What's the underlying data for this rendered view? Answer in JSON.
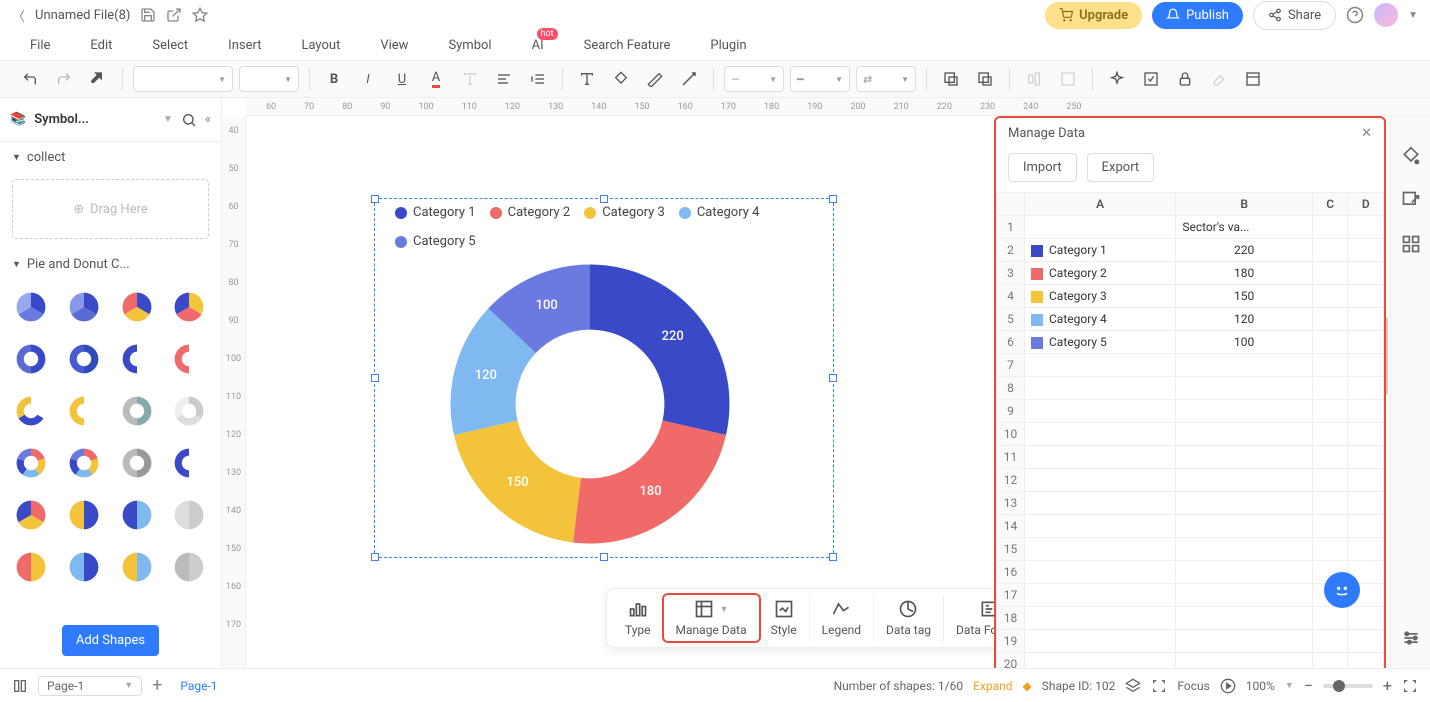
{
  "titlebar": {
    "filename": "Unnamed File(8)",
    "upgrade": "Upgrade",
    "publish": "Publish",
    "share": "Share"
  },
  "menubar": {
    "file": "File",
    "edit": "Edit",
    "select": "Select",
    "insert": "Insert",
    "layout": "Layout",
    "view": "View",
    "symbol": "Symbol",
    "ai": "AI",
    "ai_badge": "hot",
    "search": "Search Feature",
    "plugin": "Plugin"
  },
  "sidebar": {
    "title": "Symbol...",
    "collect": "collect",
    "drag": "Drag Here",
    "pie_section": "Pie and Donut C...",
    "add_shapes": "Add Shapes"
  },
  "chart_data": {
    "type": "pie",
    "title": "",
    "series_header": "Sector's va...",
    "categories": [
      "Category 1",
      "Category 2",
      "Category 3",
      "Category 4",
      "Category 5"
    ],
    "values": [
      220,
      180,
      150,
      120,
      100
    ],
    "colors": [
      "#3949c8",
      "#f06a6a",
      "#f4c33c",
      "#7fb9ef",
      "#6a7ae0"
    ]
  },
  "context_bar": {
    "type": "Type",
    "manage": "Manage Data",
    "style": "Style",
    "legend": "Legend",
    "datatag": "Data tag",
    "format": "Data Format"
  },
  "panel": {
    "title": "Manage Data",
    "import": "Import",
    "export": "Export",
    "cols": [
      "A",
      "B",
      "C",
      "D"
    ],
    "max_rows": 20
  },
  "rulerTop": [
    "60",
    "70",
    "80",
    "90",
    "100",
    "110",
    "120",
    "130",
    "140",
    "150",
    "160",
    "170",
    "180",
    "190",
    "200",
    "210",
    "220",
    "230",
    "240",
    "250"
  ],
  "rulerLeft": [
    "40",
    "50",
    "60",
    "70",
    "80",
    "90",
    "100",
    "110",
    "120",
    "130",
    "140",
    "150",
    "160",
    "170"
  ],
  "bottombar": {
    "page_combo": "Page-1",
    "active_tab": "Page-1",
    "num_shapes": "Number of shapes: 1/60",
    "expand": "Expand",
    "shape_id": "Shape ID: 102",
    "focus": "Focus",
    "zoom": "100%"
  }
}
